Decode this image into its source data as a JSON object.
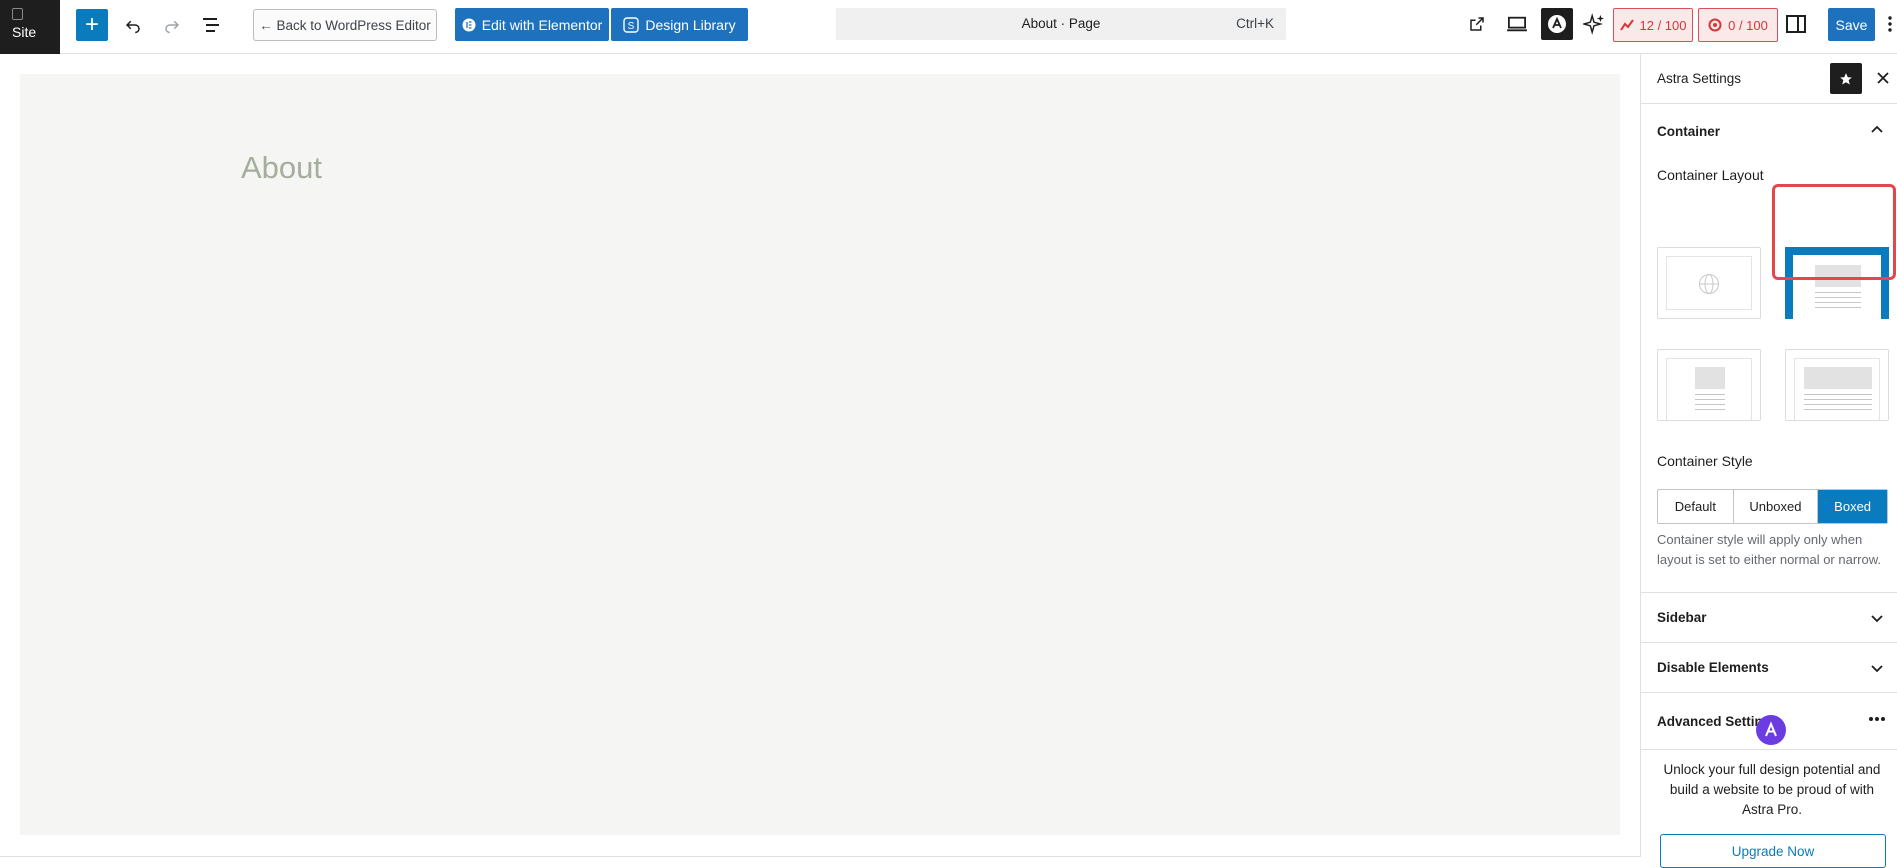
{
  "topbar": {
    "site_label": "Site",
    "back_label": "← Back to WordPress Editor",
    "elementor_label": "Edit with Elementor",
    "design_library_label": "Design Library",
    "doc_title": "About · Page",
    "shortcut": "Ctrl+K",
    "score_1": "12 / 100",
    "score_2": "0 / 100",
    "save_label": "Save"
  },
  "canvas": {
    "heading": "About"
  },
  "sidebar": {
    "title": "Astra Settings",
    "container_section": "Container",
    "container_layout_label": "Container Layout",
    "container_style_label": "Container Style",
    "style_options": [
      "Default",
      "Unboxed",
      "Boxed"
    ],
    "selected_style": "Boxed",
    "style_help": "Container style will apply only when layout is set to either normal or narrow.",
    "sidebar_section": "Sidebar",
    "disable_section": "Disable Elements",
    "advanced_section": "Advanced Settings",
    "promo_text": "Unlock your full design potential and build a website to be proud of with Astra Pro.",
    "upgrade_label": "Upgrade Now"
  },
  "colors": {
    "accent": "#1e72bd",
    "highlight": "#e0484c",
    "canvas_bg": "#f5f6f3",
    "heading": "#a4ae9d"
  }
}
